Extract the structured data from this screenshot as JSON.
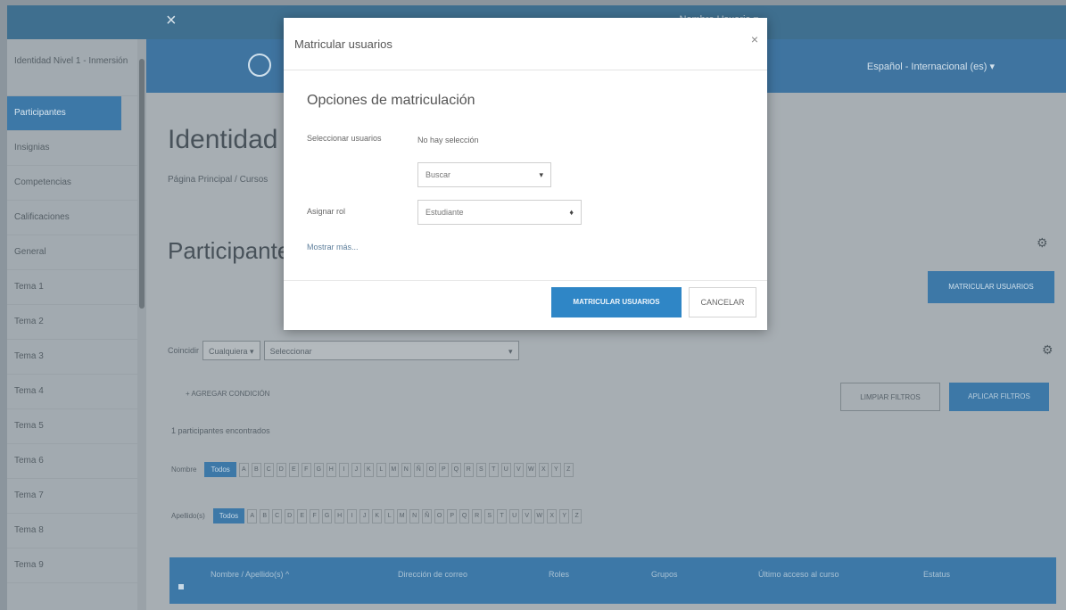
{
  "window": {
    "close_label": "×"
  },
  "topbar": {
    "user_text": "·   ·   Nombre Usuario ▾",
    "language": "Español - Internacional (es) ▾"
  },
  "sidebar": {
    "items": [
      {
        "label": "Identidad Nivel 1 - Inmersión"
      },
      {
        "label": "Participantes"
      },
      {
        "label": "Insignias"
      },
      {
        "label": "Competencias"
      },
      {
        "label": "Calificaciones"
      },
      {
        "label": "General"
      },
      {
        "label": "Tema 1"
      },
      {
        "label": "Tema 2"
      },
      {
        "label": "Tema 3"
      },
      {
        "label": "Tema 4"
      },
      {
        "label": "Tema 5"
      },
      {
        "label": "Tema 6"
      },
      {
        "label": "Tema 7"
      },
      {
        "label": "Tema 8"
      },
      {
        "label": "Tema 9"
      }
    ]
  },
  "main": {
    "title": "Identidad",
    "breadcrumb": "Página Principal / Cursos",
    "section_title": "Participantes",
    "enrol_button": "MATRICULAR USUARIOS",
    "filter": {
      "label": "Coincidir",
      "match_value": "Cualquiera ▾",
      "select_value": "Seleccionar",
      "caret": "▾"
    },
    "add_condition": "+  AGREGAR CONDICIÓN",
    "clear_filters": "LIMPIAR FILTROS",
    "apply_filters": "APLICAR FILTROS",
    "count_text": "1 participantes encontrados",
    "firstname_label": "Nombre",
    "lastname_label": "Apellido(s)",
    "all_label": "Todos",
    "letters": [
      "A",
      "B",
      "C",
      "D",
      "E",
      "F",
      "G",
      "H",
      "I",
      "J",
      "K",
      "L",
      "M",
      "N",
      "Ñ",
      "O",
      "P",
      "Q",
      "R",
      "S",
      "T",
      "U",
      "V",
      "W",
      "X",
      "Y",
      "Z"
    ],
    "table_headers": [
      "Nombre / Apellido(s) ^",
      "Dirección de correo",
      "Roles",
      "Grupos",
      "Último acceso al curso",
      "Estatus"
    ]
  },
  "modal": {
    "title": "Matricular usuarios",
    "close": "×",
    "subtitle": "Opciones de matriculación",
    "select_users_label": "Seleccionar usuarios",
    "no_selection": "No hay selección",
    "search_placeholder": "Buscar",
    "assign_role_label": "Asignar rol",
    "role_value": "Estudiante",
    "show_more": "Mostrar más...",
    "primary_button": "MATRICULAR USUARIOS",
    "cancel_button": "CANCELAR"
  },
  "colors": {
    "accent": "#2f86c6",
    "header": "#3f74a0",
    "overlay": "#a7aeb3"
  }
}
